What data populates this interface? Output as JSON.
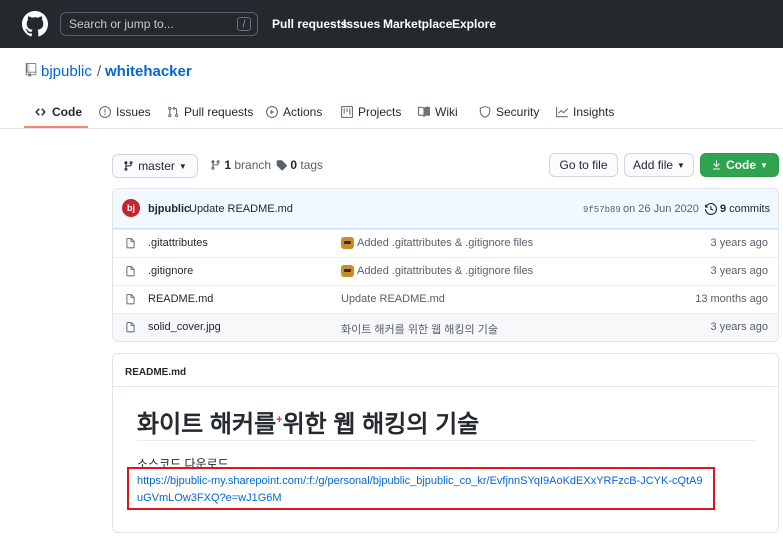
{
  "header": {
    "search_placeholder": "Search or jump to...",
    "search_shortcut": "/",
    "nav": [
      "Pull requests",
      "Issues",
      "Marketplace",
      "Explore"
    ]
  },
  "repo": {
    "owner": "bjpublic",
    "separator": "/",
    "name": "whitehacker"
  },
  "tabs": [
    {
      "label": "Code",
      "icon": "code-icon"
    },
    {
      "label": "Issues",
      "icon": "issue-icon"
    },
    {
      "label": "Pull requests",
      "icon": "pull-request-icon"
    },
    {
      "label": "Actions",
      "icon": "play-icon"
    },
    {
      "label": "Projects",
      "icon": "project-icon"
    },
    {
      "label": "Wiki",
      "icon": "book-icon"
    },
    {
      "label": "Security",
      "icon": "shield-icon"
    },
    {
      "label": "Insights",
      "icon": "graph-icon"
    }
  ],
  "branch_bar": {
    "branch": "master",
    "branch_count": "1",
    "branch_word": "branch",
    "tag_count": "0",
    "tag_word": "tags",
    "goto_file": "Go to file",
    "add_file": "Add file",
    "code": "Code"
  },
  "commit": {
    "avatar_text": "bj",
    "author": "bjpublic",
    "message": "Update README.md",
    "hash": "9f57b89",
    "date": "on 26 Jun 2020",
    "count": "9",
    "count_word": "commits"
  },
  "files": [
    {
      "name": ".gitattributes",
      "message": "Added .gitattributes & .gitignore files",
      "time": "3 years ago",
      "emoji": true
    },
    {
      "name": ".gitignore",
      "message": "Added .gitattributes & .gitignore files",
      "time": "3 years ago",
      "emoji": true
    },
    {
      "name": "README.md",
      "message": "Update README.md",
      "time": "13 months ago",
      "emoji": false
    },
    {
      "name": "solid_cover.jpg",
      "message": "화이트 해커를 위한 웹 해킹의 기술",
      "time": "3 years ago",
      "emoji": false
    }
  ],
  "readme": {
    "title": "README.md",
    "heading_pre": "화이트 해커를",
    "heading_sup": "+",
    "heading_post": "위한 웹 해킹의 기술",
    "subtext": "소스코드 다운로드",
    "link": "https://bjpublic-my.sharepoint.com/:f:/g/personal/bjpublic_bjpublic_co_kr/EvfjnnSYqI9AoKdEXxYRFzcB-JCYK-cQtA9uGVmLOw3FXQ?e=wJ1G6M"
  },
  "colors": {
    "header_bg": "#24292e",
    "link": "#0366d6",
    "code_button": "#2ea44f",
    "tab_underline": "#f9826c",
    "highlight_box": "#e0151b"
  }
}
